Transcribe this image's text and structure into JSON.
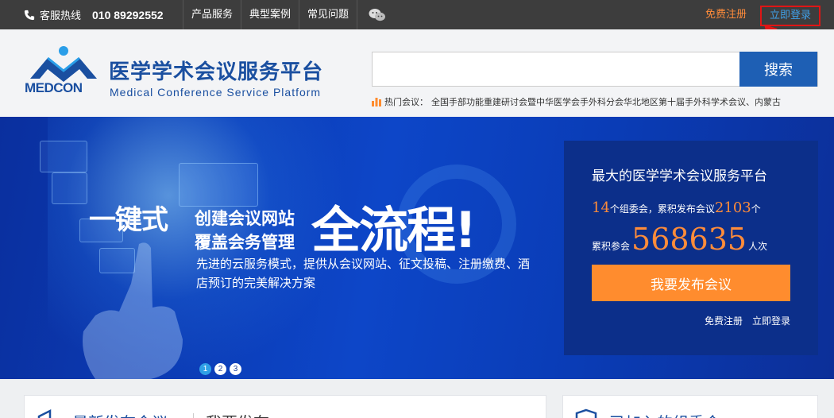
{
  "topbar": {
    "hotline_label": "客服热线",
    "hotline_number": "010 89292552",
    "nav": [
      "产品服务",
      "典型案例",
      "常见问题"
    ],
    "register": "免费注册",
    "login": "立即登录"
  },
  "header": {
    "logo_cn": "医学学术会议服务平台",
    "logo_en": "Medical Conference Service Platform",
    "logo_brand": "MEDCON",
    "search_button": "搜索",
    "search_value": "",
    "hot_label": "热门会议：",
    "hot_text": "全国手部功能重建研讨会暨中华医学会手外科分会华北地区第十届手外科学术会议、内蒙古"
  },
  "banner": {
    "slogan_1": "一键式",
    "slogan_2a": "创建会议网站",
    "slogan_2b": "覆盖会务管理",
    "slogan_3": "全流程!",
    "subtext": "先进的云服务模式，提供从会议网站、征文投稿、注册缴费、酒店预订的完美解决方案",
    "dots": [
      "1",
      "2",
      "3"
    ]
  },
  "card": {
    "title": "最大的医学学术会议服务平台",
    "committees": "14",
    "committees_suffix": "个组委会，累积发布会议",
    "meetings": "2103",
    "meetings_suffix": "个",
    "attend_prefix": "累积参会",
    "attendees": "568635",
    "attend_suffix": "人次",
    "publish_button": "我要发布会议",
    "register": "免费注册",
    "login": "立即登录"
  },
  "panels": {
    "left_title": "最新发布会议",
    "left_title2": "我要发布",
    "right_title": "已加入的组委会"
  },
  "colors": {
    "topbar": "#3d3d3d",
    "brand_blue": "#1a4fa0",
    "accent_orange": "#ff8c2e",
    "banner_blue": "#0d46c8"
  }
}
